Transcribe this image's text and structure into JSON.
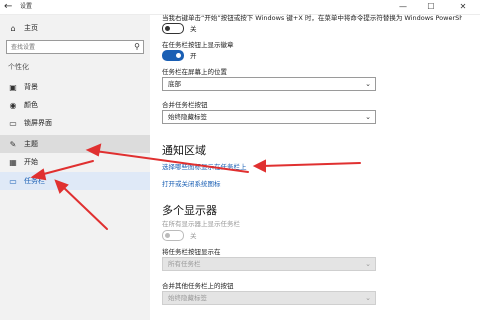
{
  "window": {
    "title": "设置",
    "back_glyph": "←",
    "minimize_glyph": "—",
    "maximize_glyph": "☐",
    "close_glyph": "✕"
  },
  "sidebar": {
    "home": {
      "label": "主页",
      "icon": "home-icon",
      "glyph": "⌂"
    },
    "search_placeholder": "查找设置",
    "search_icon_glyph": "⚲",
    "section": "个性化",
    "items": [
      {
        "label": "背景",
        "icon": "picture-icon",
        "glyph": "▣"
      },
      {
        "label": "颜色",
        "icon": "palette-icon",
        "glyph": "◉"
      },
      {
        "label": "锁屏界面",
        "icon": "lock-screen-icon",
        "glyph": "▭"
      },
      {
        "label": "主题",
        "icon": "theme-icon",
        "glyph": "✎"
      },
      {
        "label": "开始",
        "icon": "start-icon",
        "glyph": "▦"
      },
      {
        "label": "任务栏",
        "icon": "taskbar-icon",
        "glyph": "▭"
      }
    ]
  },
  "main": {
    "top_cut_text": "当我右键单击“开始”按钮或按下 Windows 键+X 时，在菜单中将命令提示符替换为 Windows PowerShell",
    "toggle1": {
      "state": "关"
    },
    "badge_label": "在任务栏按钮上显示徽章",
    "toggle2": {
      "state": "开"
    },
    "position_label": "任务栏在屏幕上的位置",
    "position_value": "底部",
    "combine_label": "合并任务栏按钮",
    "combine_value": "始终隐藏标签",
    "notify_heading": "通知区域",
    "link1": "选择哪些图标显示在任务栏上",
    "link2": "打开或关闭系统图标",
    "multi_heading": "多个显示器",
    "multi_show_label": "在所有显示器上显示任务栏",
    "toggle3": {
      "state": "关"
    },
    "show_buttons_label": "将任务栏按钮显示在",
    "show_buttons_value": "所有任务栏",
    "combine_other_label": "合并其他任务栏上的按钮",
    "combine_other_value": "始终隐藏标签",
    "chevron_glyph": "⌄"
  },
  "colors": {
    "accent": "#1a5fb4",
    "annotation_arrow": "#e03030"
  }
}
